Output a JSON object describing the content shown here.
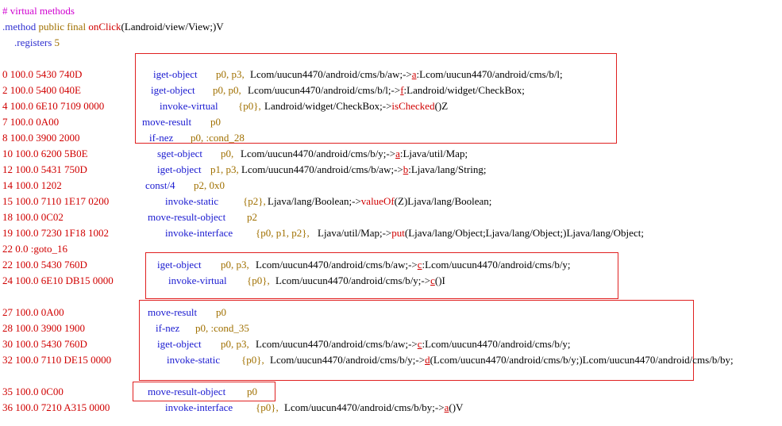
{
  "header": {
    "comment": "# virtual methods",
    "method_kw": ".method",
    "method_mods": "public final",
    "method_name": "onClick",
    "method_sig": "(Landroid/view/View;)V",
    "registers_kw": ".registers",
    "registers_val": "5"
  },
  "rows": [
    {
      "addr": "0 100.0 5430 740D",
      "op": "iget-object",
      "args": "p0, p3,",
      "rest_pre": "Lcom/uucun4470/android/cms/b/aw;->",
      "member": "a",
      "rest_post": ":Lcom/uucun4470/android/cms/b/l;"
    },
    {
      "addr": "2 100.0 5400 040E",
      "op": "iget-object",
      "args": "p0, p0,",
      "rest_pre": "Lcom/uucun4470/android/cms/b/l;->",
      "member": "f",
      "rest_post": ":Landroid/widget/CheckBox;"
    },
    {
      "addr": "4 100.0 6E10 7109 0000",
      "op": "invoke-virtual",
      "args": "{p0},",
      "rest_pre": "Landroid/widget/CheckBox;->",
      "member": "isChecked",
      "rest_post": "()Z"
    },
    {
      "addr": "7 100.0 0A00",
      "op": "move-result",
      "args": "p0"
    },
    {
      "addr": "8 100.0 3900 2000",
      "op": "if-nez",
      "args": "p0, :cond_28"
    },
    {
      "addr": "10 100.0 6200 5B0E",
      "op": "sget-object",
      "args": "p0,",
      "rest_pre": "Lcom/uucun4470/android/cms/b/y;->",
      "member": "a",
      "rest_post": ":Ljava/util/Map;"
    },
    {
      "addr": "12 100.0 5431 750D",
      "op": "iget-object",
      "args": "p1, p3,",
      "rest_pre": "Lcom/uucun4470/android/cms/b/aw;->",
      "member": "b",
      "rest_post": ":Ljava/lang/String;"
    },
    {
      "addr": "14 100.0 1202",
      "op": "const/4",
      "args": "p2, 0x0"
    },
    {
      "addr": "15 100.0 7110 1E17 0200",
      "op": "invoke-static",
      "args": "{p2},",
      "rest_pre": "Ljava/lang/Boolean;->",
      "member": "valueOf",
      "rest_post": "(Z)Ljava/lang/Boolean;"
    },
    {
      "addr": "18 100.0 0C02",
      "op": "move-result-object",
      "args": "p2"
    },
    {
      "addr": "19 100.0 7230 1F18 1002",
      "op": "invoke-interface",
      "args": "{p0, p1, p2},",
      "rest_pre": "Ljava/util/Map;->",
      "member": "put",
      "rest_post": "(Ljava/lang/Object;Ljava/lang/Object;)Ljava/lang/Object;"
    },
    {
      "addr": "22 0.0 :goto_16"
    },
    {
      "addr": "22 100.0 5430 760D",
      "op": "iget-object",
      "args": "p0, p3,",
      "rest_pre": "Lcom/uucun4470/android/cms/b/aw;->",
      "member": "c",
      "rest_post": ":Lcom/uucun4470/android/cms/b/y;"
    },
    {
      "addr": "24 100.0 6E10 DB15 0000",
      "op": "invoke-virtual",
      "args": "{p0},",
      "rest_pre": "Lcom/uucun4470/android/cms/b/y;->",
      "member": "c",
      "rest_post": "()I"
    },
    {
      "addr": "27 100.0 0A00",
      "op": "move-result",
      "args": "p0"
    },
    {
      "addr": "28 100.0 3900 1900",
      "op": "if-nez",
      "args": "p0, :cond_35"
    },
    {
      "addr": "30 100.0 5430 760D",
      "op": "iget-object",
      "args": "p0, p3,",
      "rest_pre": "Lcom/uucun4470/android/cms/b/aw;->",
      "member": "c",
      "rest_post": ":Lcom/uucun4470/android/cms/b/y;"
    },
    {
      "addr": "32 100.0 7110 DE15 0000",
      "op": "invoke-static",
      "args": "{p0},",
      "rest_pre": "Lcom/uucun4470/android/cms/b/y;->",
      "member": "d",
      "rest_post": "(Lcom/uucun4470/android/cms/b/y;)Lcom/uucun4470/android/cms/b/by;"
    },
    {
      "addr": "35 100.0 0C00",
      "op": "move-result-object",
      "args": "p0"
    },
    {
      "addr": "36 100.0 7210 A315 0000",
      "op": "invoke-interface",
      "args": "{p0},",
      "rest_pre": "Lcom/uucun4470/android/cms/b/by;->",
      "member": "a",
      "rest_post": "()V"
    }
  ],
  "colors": {
    "comment": "#d000d0",
    "keyword": "#3030d0",
    "register": "#a07000",
    "address": "#d00000",
    "highlight_box": "#e02020"
  }
}
